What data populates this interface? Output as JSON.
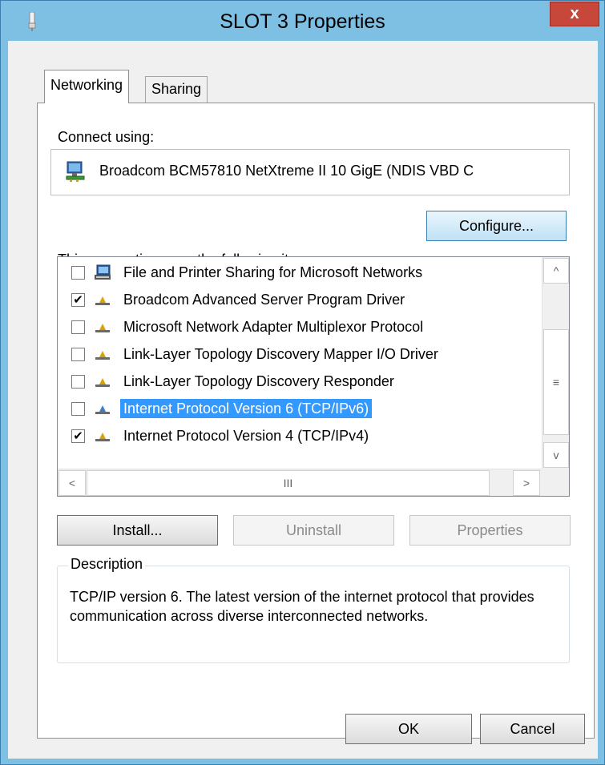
{
  "window": {
    "title": "SLOT 3 Properties",
    "close_glyph": "x",
    "app_icon": "network-adapter-icon"
  },
  "tabs": [
    {
      "label": "Networking",
      "selected": true
    },
    {
      "label": "Sharing",
      "selected": false
    }
  ],
  "connect_using": {
    "label": "Connect using:",
    "adapter_name": "Broadcom BCM57810 NetXtreme II 10 GigE (NDIS VBD C",
    "adapter_icon": "network-adapter-icon"
  },
  "buttons": {
    "configure": "Configure...",
    "install": "Install...",
    "uninstall": "Uninstall",
    "properties": "Properties",
    "ok": "OK",
    "cancel": "Cancel"
  },
  "items_label": "This connection uses the following items:",
  "items": [
    {
      "label": "File and Printer Sharing for Microsoft Networks",
      "checked": false,
      "icon": "computer-icon",
      "selected": false
    },
    {
      "label": "Broadcom Advanced Server Program Driver",
      "checked": true,
      "icon": "protocol-icon",
      "selected": false
    },
    {
      "label": "Microsoft Network Adapter Multiplexor Protocol",
      "checked": false,
      "icon": "protocol-icon",
      "selected": false
    },
    {
      "label": "Link-Layer Topology Discovery Mapper I/O Driver",
      "checked": false,
      "icon": "protocol-icon",
      "selected": false
    },
    {
      "label": "Link-Layer Topology Discovery Responder",
      "checked": false,
      "icon": "protocol-icon",
      "selected": false
    },
    {
      "label": "Internet Protocol Version 6 (TCP/IPv6)",
      "checked": false,
      "icon": "protocol-icon",
      "selected": true
    },
    {
      "label": "Internet Protocol Version 4 (TCP/IPv4)",
      "checked": true,
      "icon": "protocol-icon",
      "selected": false
    }
  ],
  "scrollbar": {
    "up": "^",
    "down": "v",
    "grip": "≡",
    "left": "<",
    "right": ">",
    "hgrip": "III"
  },
  "description": {
    "legend": "Description",
    "text": "TCP/IP version 6. The latest version of the internet protocol that provides communication across diverse interconnected networks."
  },
  "colors": {
    "selection": "#3399ff",
    "close_button": "#c7473b",
    "frame": "#7ec0e4"
  }
}
